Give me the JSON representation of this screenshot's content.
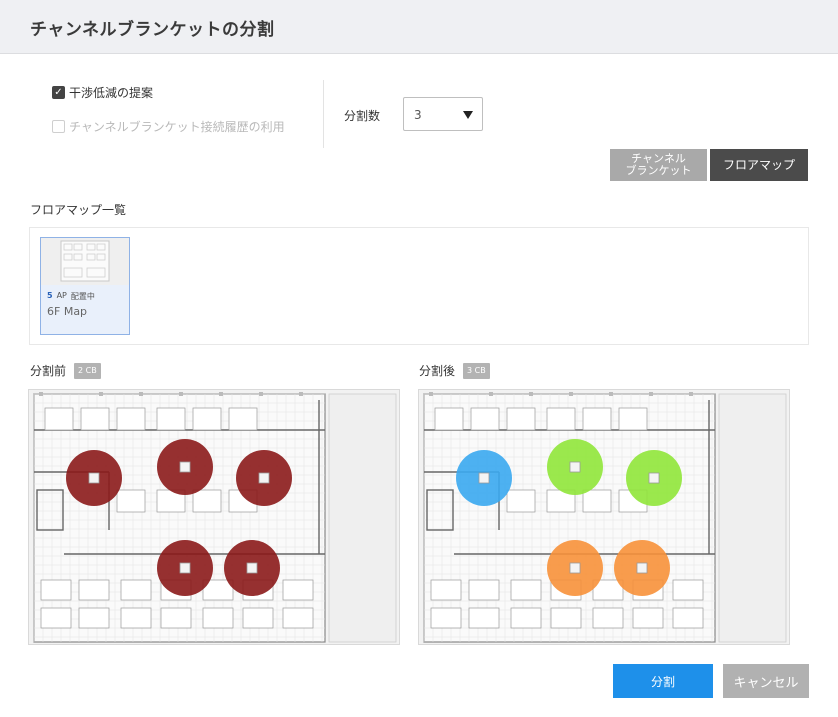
{
  "header": {
    "title": "チャンネルブランケットの分割"
  },
  "options": {
    "interference": {
      "label": "干渉低減の提案",
      "checked": true
    },
    "history": {
      "label": "チャンネルブランケット接続履歴の利用",
      "checked": false,
      "disabled": true
    }
  },
  "split": {
    "label": "分割数",
    "value": "3"
  },
  "view_toggle": {
    "channel_label": "チャンネル\nブランケット",
    "floor_label": "フロアマップ",
    "active": "floor"
  },
  "floor_list": {
    "title": "フロアマップ一覧",
    "items": [
      {
        "ap_count": "5",
        "ap_label": "AP",
        "status": "配置中",
        "name": "6F Map"
      }
    ]
  },
  "maps": {
    "before": {
      "label": "分割前",
      "badge": "2 CB"
    },
    "after": {
      "label": "分割後",
      "badge": "3 CB"
    }
  },
  "colors": {
    "before_ap": "#8b1a1a",
    "after_blue": "#3aa9ef",
    "after_green": "#90e63a",
    "after_orange": "#f7913a",
    "primary": "#1e90ea"
  },
  "buttons": {
    "split": "分割",
    "cancel": "キャンセル"
  }
}
